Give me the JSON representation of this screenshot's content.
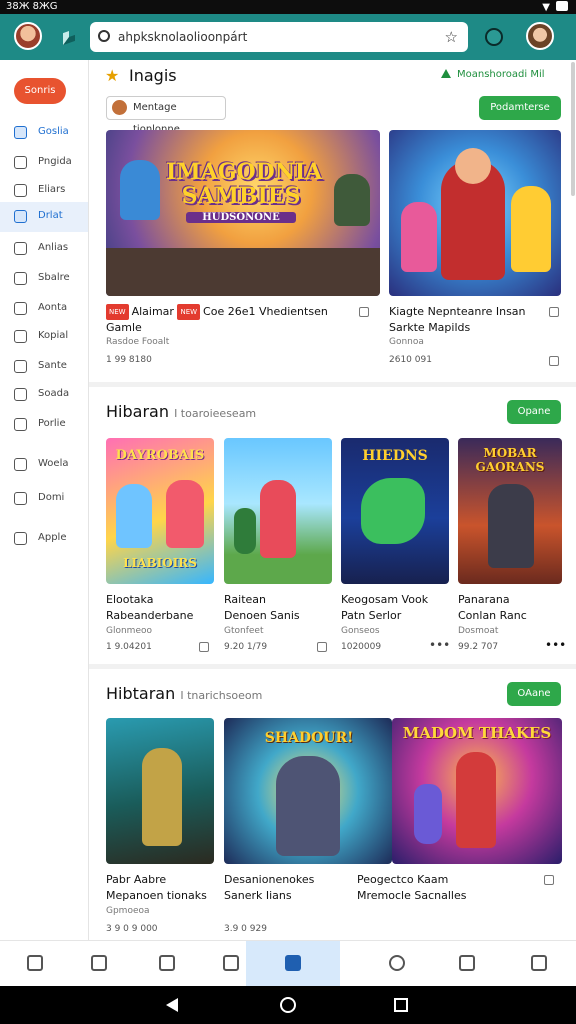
{
  "status": {
    "time": "38Ж 8ЖG"
  },
  "search": {
    "value": "ahpksknolaolioonpárt"
  },
  "sidebar": {
    "primary_button": "Sonris",
    "items": [
      {
        "label": "Goslia",
        "icon": "pencil-icon",
        "active": false,
        "blue": true
      },
      {
        "label": "Pngida",
        "icon": "grid-icon",
        "active": false,
        "blue": false
      },
      {
        "label": "Eliars",
        "icon": "document-icon",
        "active": false,
        "blue": false
      },
      {
        "label": "Drlat",
        "icon": "chart-icon",
        "active": true,
        "blue": true
      },
      {
        "label": "Anlias",
        "icon": "link-icon",
        "active": false,
        "blue": false
      },
      {
        "label": "Sbalre",
        "icon": "folder-icon",
        "active": false,
        "blue": false
      },
      {
        "label": "Aonta",
        "icon": "chat-icon",
        "active": false,
        "blue": false
      },
      {
        "label": "Kopial",
        "icon": "tag-icon",
        "active": false,
        "blue": false
      },
      {
        "label": "Sante",
        "icon": "user-icon",
        "active": false,
        "blue": false
      },
      {
        "label": "Soada",
        "icon": "bag-icon",
        "active": false,
        "blue": false
      },
      {
        "label": "Porlie",
        "icon": "edit-icon",
        "active": false,
        "blue": false
      },
      {
        "label": "Woela",
        "icon": "bookmark-icon",
        "active": false,
        "blue": false
      },
      {
        "label": "Domi",
        "icon": "home-icon",
        "active": false,
        "blue": false
      },
      {
        "label": "Apple",
        "icon": "clock-icon",
        "active": false,
        "blue": false
      }
    ]
  },
  "section1": {
    "title": "Inagis",
    "right_link": "Moanshoroadi Mil",
    "chip": "Mentage tionlonne",
    "action": "Podamterse",
    "cards": [
      {
        "art_title": "IMAGODNIA SAMBIES",
        "art_sub": "HUDSONONE",
        "title_line1": "Alaimar",
        "badge1": "NEW",
        "badge2": "NEW",
        "title_rest": "Coe 26e1 Vhedientsen",
        "title_line2": "Gamle",
        "sub": "Rasdoe Fooalt",
        "meta": "1 99 8180"
      },
      {
        "art_title": "",
        "title_line1": "Kiagte Nepnteanre Insan",
        "title_line2": "Sarkte Mapilds",
        "sub": "Gonnoa",
        "meta": "2610 091"
      }
    ]
  },
  "section2": {
    "title": "Hibaran",
    "subtitle": "I toaroieeseam",
    "action": "Opane",
    "cards": [
      {
        "art_title": "DAYROBAIS",
        "art_bottom": "LIABIOIRS",
        "title1": "Elootaka",
        "title2": "Rabeanderbane",
        "sub": "Glonmeoo",
        "meta": "1 9.04201"
      },
      {
        "art_title": "",
        "title1": "Raitean",
        "title2": "Denoen Sanis",
        "sub": "Gtonfeet",
        "meta": "9.20 1/79"
      },
      {
        "art_title": "HIEDNS",
        "title1": "Keogosam Vook",
        "title2": "Patn Serlor",
        "sub": "Gonseos",
        "meta": "1020009"
      },
      {
        "art_title": "MOBAR GAORANS",
        "title1": "Panarana",
        "title2": "Conlan Ranc",
        "sub": "Dosmoat",
        "meta": "99.2 707"
      }
    ]
  },
  "section3": {
    "title": "Hibtaran",
    "subtitle": "I tnarichsoeom",
    "action": "OAane",
    "cards": [
      {
        "art_title": "",
        "title1": "Pabr Aabre",
        "title2": "Mepanoen tionaks",
        "sub": "Gpmoeoa",
        "meta": "3 9 0 9 000"
      },
      {
        "art_title": "SHADOUR!",
        "title1": "Desanionenokes",
        "title2": "Sanerk Iians",
        "sub": "",
        "meta": "3.9 0 929"
      },
      {
        "art_title": "MADOM THAKES",
        "title1": "Peogectco Kaam",
        "title2": "Mremocle Sacnalles",
        "sub": "",
        "meta": ""
      }
    ]
  },
  "bottom_nav": {
    "items": [
      {
        "icon": "home-icon"
      },
      {
        "icon": "play-icon"
      },
      {
        "icon": "tablet-icon"
      },
      {
        "icon": "book-icon"
      },
      {
        "icon": "apps-icon",
        "active": true
      },
      {
        "icon": "compass-icon"
      },
      {
        "icon": "settings-icon"
      },
      {
        "icon": "profile-icon"
      }
    ]
  }
}
